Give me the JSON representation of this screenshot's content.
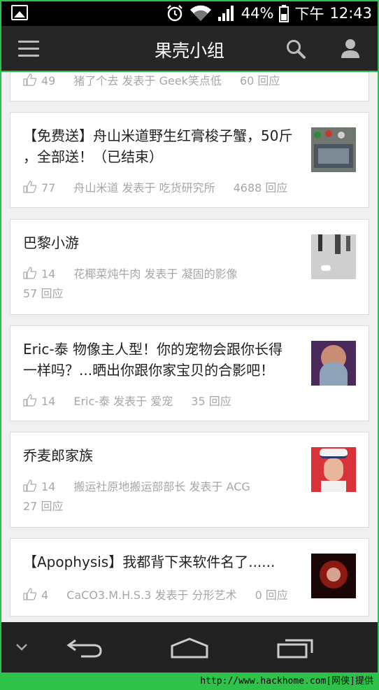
{
  "status_bar": {
    "battery": "44%",
    "am_pm": "下午",
    "time": "12:43"
  },
  "app": {
    "title": "果壳小组"
  },
  "posts": [
    {
      "title": "",
      "likes": "49",
      "author": "猪了个去",
      "posted_in": "发表于",
      "group": "Geek笑点低",
      "replies": "60 回应"
    },
    {
      "title": "【免费送】舟山米道野生红膏梭子蟹，50斤，全部送！（已结束）",
      "title_line1": "【免费送】舟山米道野生红膏梭子蟹，50斤",
      "title_line2": "，全部送！（已结束）",
      "likes": "77",
      "author": "舟山米道",
      "posted_in": "发表于",
      "group": "吃货研究所",
      "replies": "4688 回应"
    },
    {
      "title": "巴黎小游",
      "likes": "14",
      "author": "花椰菜炖牛肉",
      "posted_in": "发表于",
      "group": "凝固的影像",
      "replies": "57 回应"
    },
    {
      "title_line1": "Eric-泰 物像主人型！你的宠物会跟你长得",
      "title_line2": "一样吗？...晒出你跟你家宝贝的合影吧！",
      "likes": "14",
      "author": "Eric-泰",
      "posted_in": "发表于",
      "group": "爱宠",
      "replies": "35 回应"
    },
    {
      "title": "乔麦郎家族",
      "likes": "14",
      "author": "搬运社原地搬运部部长",
      "posted_in": "发表于",
      "group": "ACG",
      "replies": "27 回应"
    },
    {
      "title": "【Apophysis】我都背下来软件名了......",
      "likes": "4",
      "author": "CaCO3.M.H.S.3",
      "posted_in": "发表于",
      "group": "分形艺术",
      "replies": "0 回应"
    }
  ],
  "watermark": "http://www.hackhome.com[网侠]提供",
  "colors": {
    "accent": "#2ec24a",
    "actionbar": "#262626",
    "meta_text": "#a6a6a6"
  }
}
